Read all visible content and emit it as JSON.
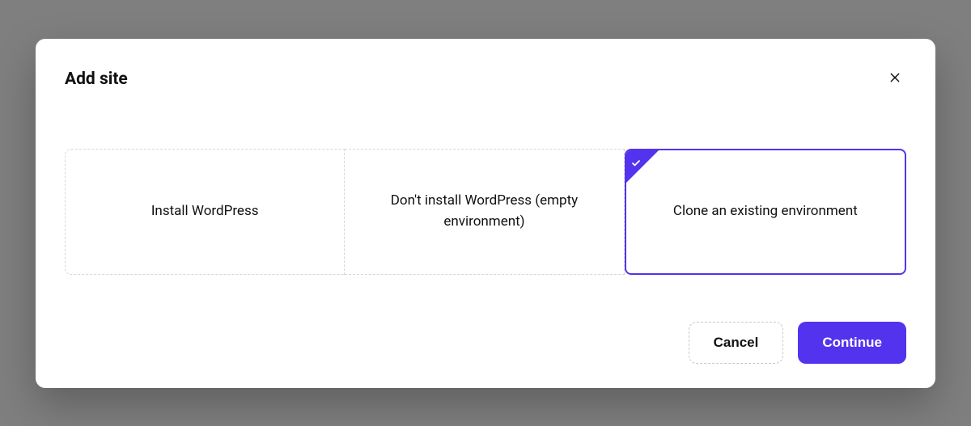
{
  "dialog": {
    "title": "Add site"
  },
  "options": [
    {
      "label": "Install WordPress",
      "selected": false
    },
    {
      "label": "Don't install WordPress (empty environment)",
      "selected": false
    },
    {
      "label": "Clone an existing environment",
      "selected": true
    }
  ],
  "footer": {
    "cancel_label": "Cancel",
    "continue_label": "Continue"
  },
  "colors": {
    "accent": "#5333ed"
  }
}
